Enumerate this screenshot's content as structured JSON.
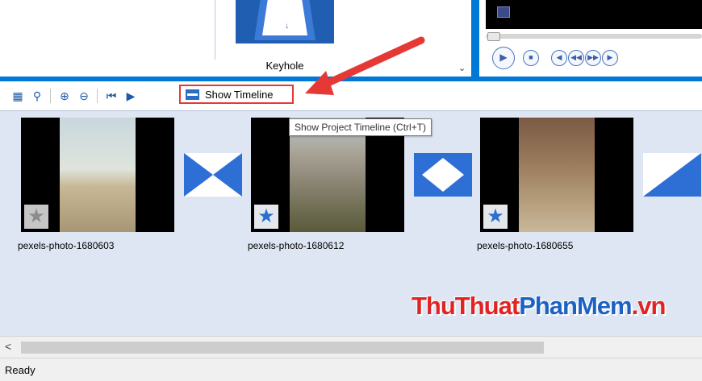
{
  "transitions_pane": {
    "selected_transition": "Keyhole",
    "scroll_icon": "chevron-down-icon"
  },
  "player": {
    "buttons": [
      "play-icon",
      "stop-icon",
      "previous-frame-icon",
      "rewind-icon",
      "fast-forward-icon",
      "next-frame-icon"
    ]
  },
  "toolbar": {
    "show_timeline_label": "Show Timeline",
    "icons": [
      "set-audio-levels-icon",
      "narrate-icon",
      "zoom-in-icon",
      "zoom-out-icon",
      "rewind-storyboard-icon",
      "play-storyboard-icon",
      "timeline-icon"
    ]
  },
  "tooltip": {
    "text": "Show Project Timeline (Ctrl+T)"
  },
  "storyboard": {
    "clips": [
      {
        "name": "pexels-photo-1680603",
        "effect_icon": "star-icon"
      },
      {
        "name": "pexels-photo-1680612",
        "effect_icon": "star-icon"
      },
      {
        "name": "pexels-photo-1680655",
        "effect_icon": "star-icon"
      }
    ],
    "transitions": [
      "bow-tie-transition",
      "diamond-transition",
      "diagonal-transition"
    ]
  },
  "watermark": {
    "part1": "ThuThuat",
    "part2": "PhanMem",
    "part3": ".vn"
  },
  "scrollbar": {
    "left_arrow": "<"
  },
  "status": {
    "text": "Ready"
  },
  "colors": {
    "accent": "#0078d7",
    "highlight_box": "#e53935",
    "storyboard_bg": "#dde6f2"
  }
}
